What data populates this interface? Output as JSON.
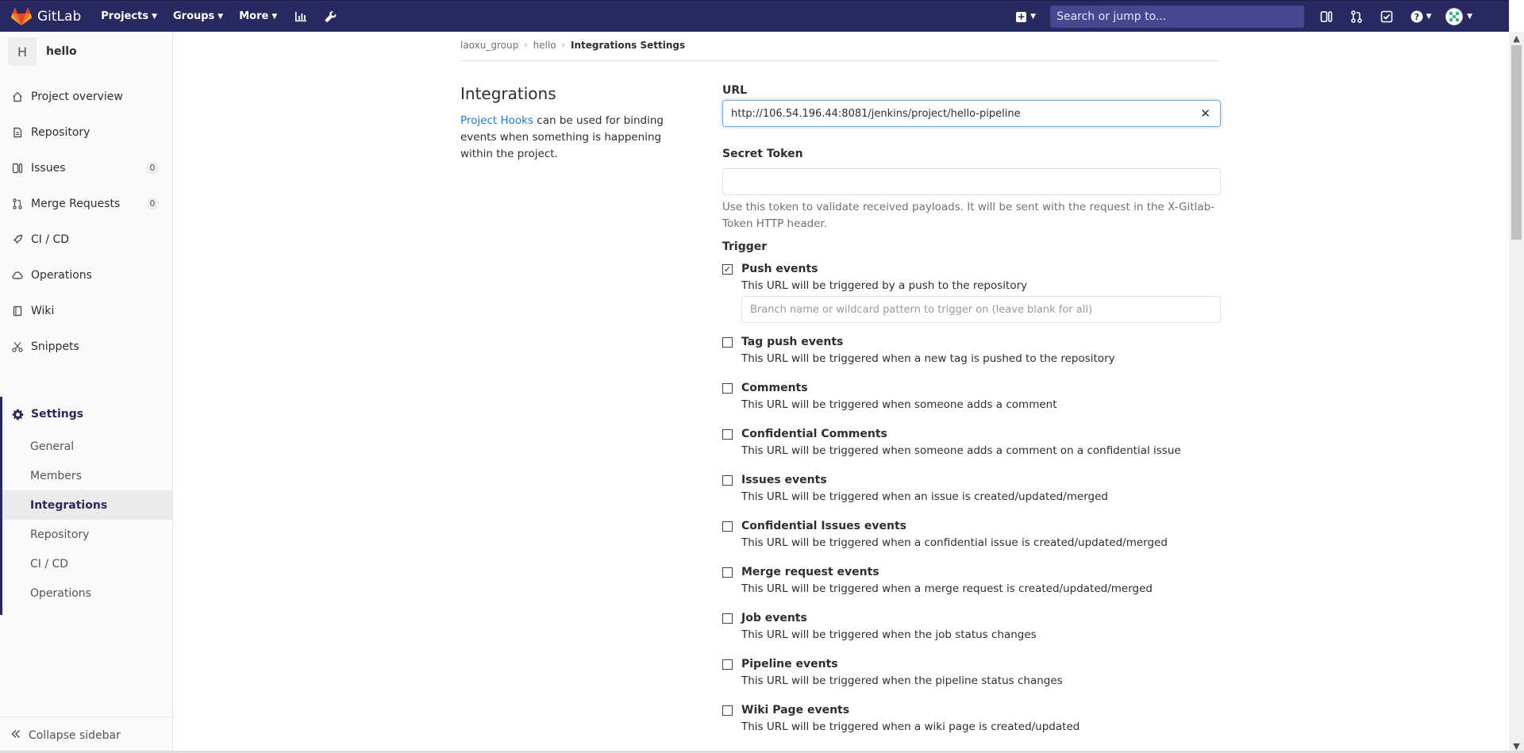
{
  "navbar": {
    "brand": "GitLab",
    "links": [
      {
        "label": "Projects"
      },
      {
        "label": "Groups"
      },
      {
        "label": "More"
      }
    ],
    "search_placeholder": "Search or jump to...",
    "colors": {
      "navbar_bg": "#292961",
      "search_bg": "#474791"
    }
  },
  "sidebar": {
    "project_initial": "H",
    "project_name": "hello",
    "items": [
      {
        "label": "Project overview",
        "icon": "home-icon"
      },
      {
        "label": "Repository",
        "icon": "doc-icon"
      },
      {
        "label": "Issues",
        "icon": "issues-icon",
        "badge": "0"
      },
      {
        "label": "Merge Requests",
        "icon": "merge-icon",
        "badge": "0"
      },
      {
        "label": "CI / CD",
        "icon": "rocket-icon"
      },
      {
        "label": "Operations",
        "icon": "cloud-icon"
      },
      {
        "label": "Wiki",
        "icon": "book-icon"
      },
      {
        "label": "Snippets",
        "icon": "scissors-icon"
      }
    ],
    "settings": {
      "label": "Settings",
      "sub_items": [
        {
          "label": "General"
        },
        {
          "label": "Members"
        },
        {
          "label": "Integrations",
          "active": true
        },
        {
          "label": "Repository"
        },
        {
          "label": "CI / CD"
        },
        {
          "label": "Operations"
        }
      ]
    },
    "collapse_label": "Collapse sidebar"
  },
  "breadcrumb": [
    "laoxu_group",
    "hello",
    "Integrations Settings"
  ],
  "intro": {
    "title": "Integrations",
    "link_text": "Project Hooks",
    "text": " can be used for binding events when something is happening within the project."
  },
  "form": {
    "url_label": "URL",
    "url_value": "http://106.54.196.44:8081/jenkins/project/hello-pipeline",
    "secret_label": "Secret Token",
    "secret_value": "",
    "secret_help": "Use this token to validate received payloads. It will be sent with the request in the X-Gitlab-Token HTTP header.",
    "trigger_label": "Trigger",
    "branch_placeholder": "Branch name or wildcard pattern to trigger on (leave blank for all)",
    "triggers": [
      {
        "title": "Push events",
        "desc": "This URL will be triggered by a push to the repository",
        "checked": true
      },
      {
        "title": "Tag push events",
        "desc": "This URL will be triggered when a new tag is pushed to the repository",
        "checked": false
      },
      {
        "title": "Comments",
        "desc": "This URL will be triggered when someone adds a comment",
        "checked": false
      },
      {
        "title": "Confidential Comments",
        "desc": "This URL will be triggered when someone adds a comment on a confidential issue",
        "checked": false
      },
      {
        "title": "Issues events",
        "desc": "This URL will be triggered when an issue is created/updated/merged",
        "checked": false
      },
      {
        "title": "Confidential Issues events",
        "desc": "This URL will be triggered when a confidential issue is created/updated/merged",
        "checked": false
      },
      {
        "title": "Merge request events",
        "desc": "This URL will be triggered when a merge request is created/updated/merged",
        "checked": false
      },
      {
        "title": "Job events",
        "desc": "This URL will be triggered when the job status changes",
        "checked": false
      },
      {
        "title": "Pipeline events",
        "desc": "This URL will be triggered when the pipeline status changes",
        "checked": false
      },
      {
        "title": "Wiki Page events",
        "desc": "This URL will be triggered when a wiki page is created/updated",
        "checked": false
      }
    ]
  }
}
